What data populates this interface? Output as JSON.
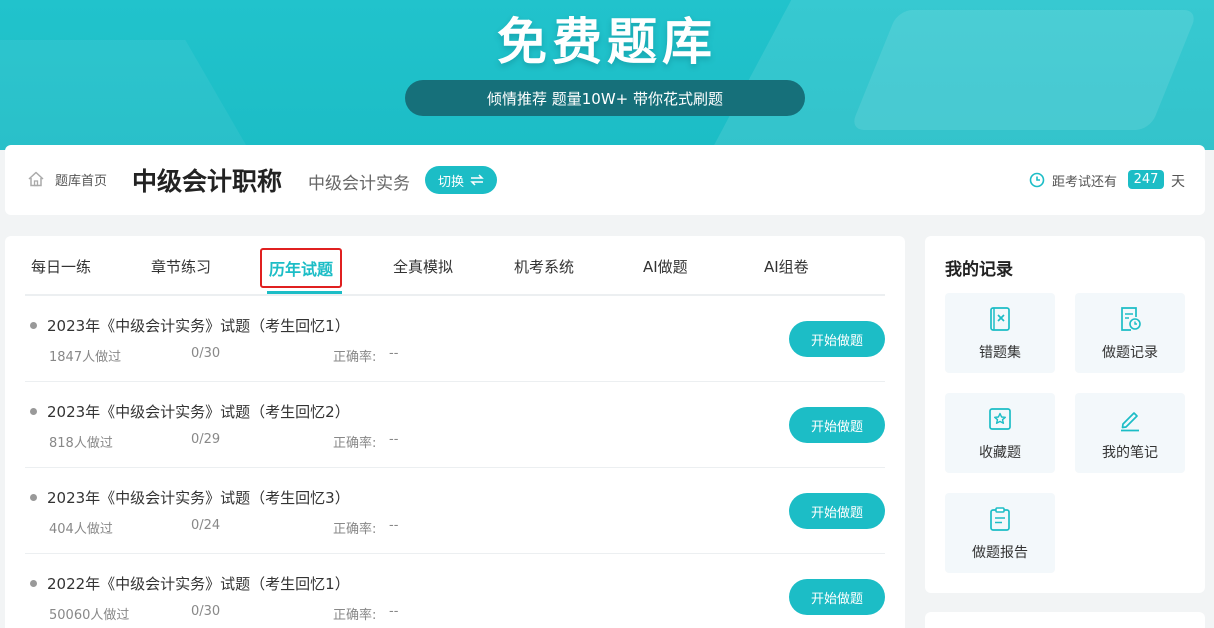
{
  "banner": {
    "title": "免费题库",
    "slogan": "倾情推荐 题量10W+ 带你花式刷题"
  },
  "header": {
    "home_link": "题库首页",
    "subject_title": "中级会计职称",
    "subject_sub": "中级会计实务",
    "switch_label": "切换",
    "countdown_label": "距考试还有",
    "countdown_value": "247",
    "countdown_unit": "天"
  },
  "tabs": [
    {
      "label": "每日一练"
    },
    {
      "label": "章节练习"
    },
    {
      "label": "历年试题",
      "active": true
    },
    {
      "label": "全真模拟"
    },
    {
      "label": "机考系统"
    },
    {
      "label": "AI做题"
    },
    {
      "label": "AI组卷"
    }
  ],
  "exams": [
    {
      "title": "2023年《中级会计实务》试题（考生回忆1）",
      "people": "1847人做过",
      "progress": "0/30",
      "rate_label": "正确率:",
      "rate_value": "--",
      "button": "开始做题"
    },
    {
      "title": "2023年《中级会计实务》试题（考生回忆2）",
      "people": "818人做过",
      "progress": "0/29",
      "rate_label": "正确率:",
      "rate_value": "--",
      "button": "开始做题"
    },
    {
      "title": "2023年《中级会计实务》试题（考生回忆3）",
      "people": "404人做过",
      "progress": "0/24",
      "rate_label": "正确率:",
      "rate_value": "--",
      "button": "开始做题"
    },
    {
      "title": "2022年《中级会计实务》试题（考生回忆1）",
      "people": "50060人做过",
      "progress": "0/30",
      "rate_label": "正确率:",
      "rate_value": "--",
      "button": "开始做题"
    }
  ],
  "records": {
    "title": "我的记录",
    "items": [
      {
        "label": "错题集",
        "icon": "wrong-book-icon"
      },
      {
        "label": "做题记录",
        "icon": "history-icon"
      },
      {
        "label": "收藏题",
        "icon": "star-icon"
      },
      {
        "label": "我的笔记",
        "icon": "pen-icon"
      },
      {
        "label": "做题报告",
        "icon": "clipboard-icon"
      }
    ]
  },
  "colors": {
    "accent": "#1cbdc6",
    "banner_pill": "#16707a",
    "active_tab_border": "#e02020"
  }
}
